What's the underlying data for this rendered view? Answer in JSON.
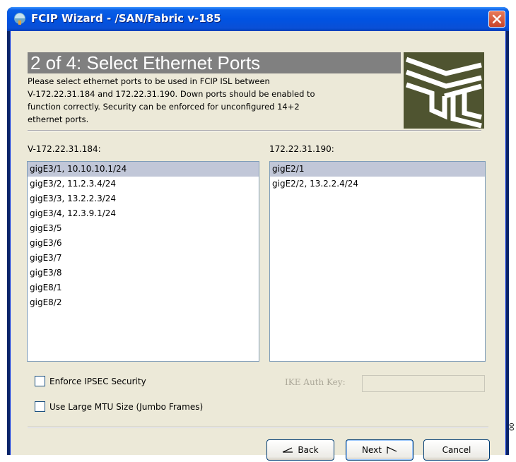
{
  "window": {
    "title": "FCIP Wizard - /SAN/Fabric v-185"
  },
  "header": {
    "step_title": "2 of 4: Select Ethernet Ports",
    "description_lines": [
      "Please select ethernet ports to be used in FCIP ISL between",
      "V-172.22.31.184 and 172.22.31.190.  Down ports should be enabled to",
      "function correctly. Security can be enforced for unconfigured 14+2",
      "ethernet ports."
    ]
  },
  "left_list": {
    "label": "V-172.22.31.184:",
    "items": [
      "gigE3/1, 10.10.10.1/24",
      "gigE3/2, 11.2.3.4/24",
      "gigE3/3, 13.2.2.3/24",
      "gigE3/4, 12.3.9.1/24",
      "gigE3/5",
      "gigE3/6",
      "gigE3/7",
      "gigE3/8",
      "gigE8/1",
      "gigE8/2"
    ],
    "selected_index": 0
  },
  "right_list": {
    "label": "172.22.31.190:",
    "items": [
      "gigE2/1",
      "gigE2/2, 13.2.2.4/24"
    ],
    "selected_index": 0
  },
  "options": {
    "enforce_ipsec_label": "Enforce IPSEC Security",
    "jumbo_label": "Use Large MTU Size (Jumbo Frames)",
    "ike_label": "IKE Auth Key:",
    "ike_value": ""
  },
  "buttons": {
    "back": "Back",
    "next": "Next",
    "cancel": "Cancel"
  },
  "side_number": "00"
}
